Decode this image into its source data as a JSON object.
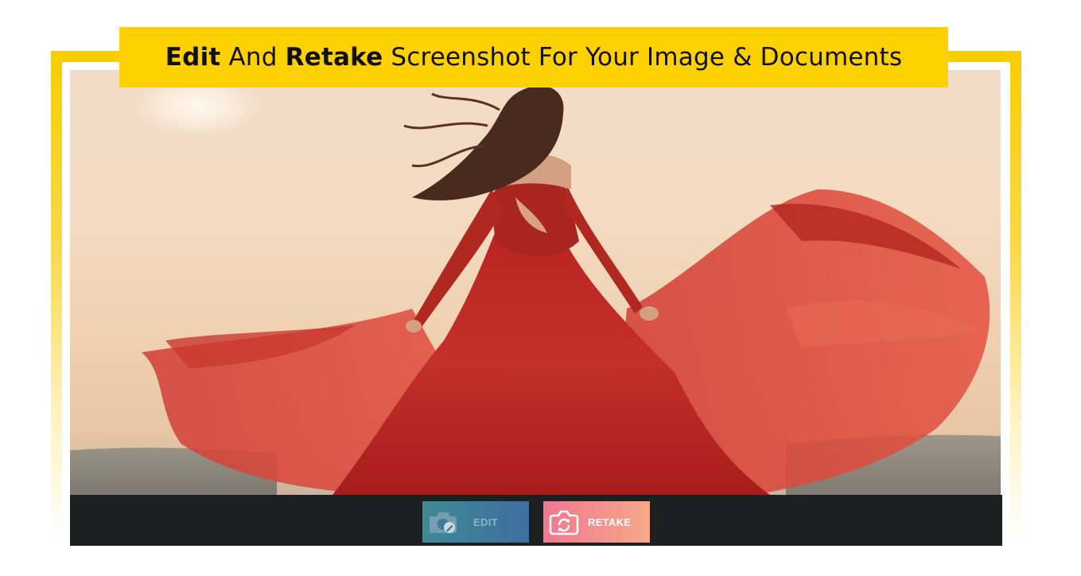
{
  "banner": {
    "word1": "Edit",
    "word2": " And ",
    "word3": "Retake",
    "word4": " Screenshot For Your Image & Documents"
  },
  "toolbar": {
    "edit_label": "EDIT",
    "edit_icon": "camera-edit-icon",
    "retake_label": "RETAKE",
    "retake_icon": "camera-retake-icon"
  },
  "colors": {
    "accent_yellow": "#fdd100",
    "bar_background": "#1e1f21",
    "edit_button": "#3d7a9c",
    "retake_button": "#f38c8d"
  }
}
